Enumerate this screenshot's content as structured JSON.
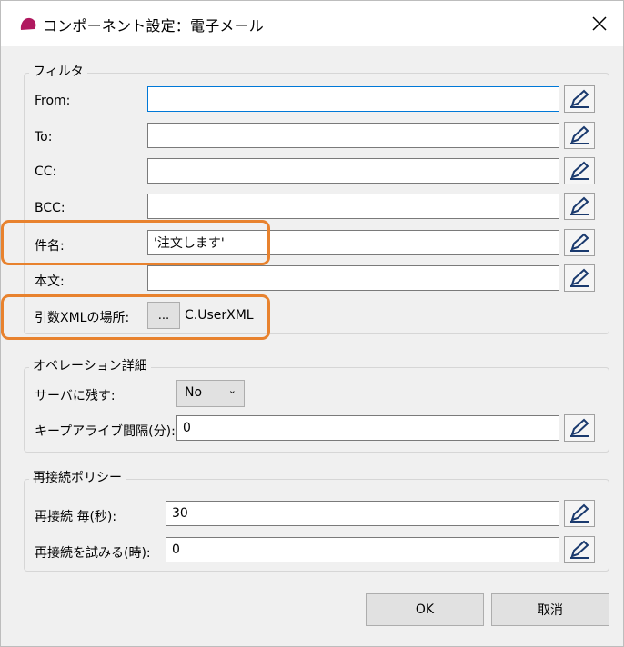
{
  "window": {
    "title": "コンポーネント設定：電子メール"
  },
  "filter": {
    "title": "フィルタ",
    "from_label": "From:",
    "from_value": "",
    "to_label": "To:",
    "to_value": "",
    "cc_label": "CC:",
    "cc_value": "",
    "bcc_label": "BCC:",
    "bcc_value": "",
    "subject_label": "件名:",
    "subject_value": "'注文します'",
    "body_label": "本文:",
    "body_value": "",
    "xml_label": "引数XMLの場所:",
    "xml_browse": "...",
    "xml_value": "C.UserXML"
  },
  "operation": {
    "title": "オペレーション詳細",
    "leave_label": "サーバに残す:",
    "leave_value": "No",
    "keepalive_label": "キープアライブ間隔(分):",
    "keepalive_value": "0"
  },
  "reconnect": {
    "title": "再接続ポリシー",
    "every_label": "再接続 毎(秒):",
    "every_value": "30",
    "try_label": "再接続を試みる(時):",
    "try_value": "0"
  },
  "buttons": {
    "ok": "OK",
    "cancel": "取消"
  },
  "colors": {
    "highlight": "#e8822e",
    "focus": "#0078d7",
    "icon": "#b0195f"
  },
  "icons": [
    "app-logo-icon",
    "close-icon",
    "pencil-icon",
    "chevron-down-icon"
  ]
}
